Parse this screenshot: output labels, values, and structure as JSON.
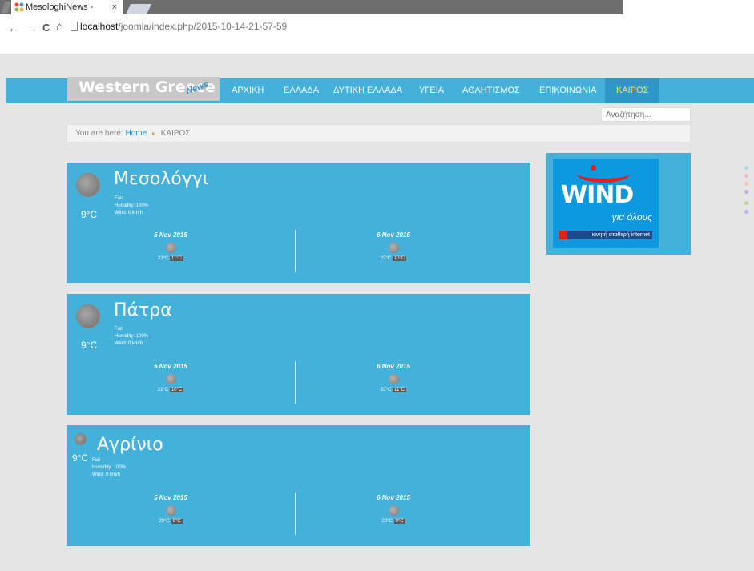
{
  "browser": {
    "tab_title": "MesologhiNews - ΚΑΙΡΟΣ",
    "tab_close": "×",
    "url_host": "localhost",
    "url_path": "/joomla/index.php/2015-10-14-21-57-59",
    "back_glyph": "←",
    "forward_glyph": "→",
    "reload_glyph": "C",
    "home_glyph": "⌂"
  },
  "site": {
    "logo": "Western Greece",
    "logo_sub": "News",
    "menu": [
      "ΑΡΧΙΚΗ",
      "ΕΛΛΑΔΑ",
      "ΔΥΤΙΚΗ ΕΛΛΑΔΑ",
      "ΥΓΕΙΑ",
      "ΑΘΛΗΤΙΣΜΟΣ",
      "ΕΠΙΚΟΙΝΩΝΙΑ",
      "ΚΑΙΡΟΣ"
    ],
    "active_menu": "ΚΑΙΡΟΣ",
    "search_placeholder": "Αναζήτηση...",
    "breadcrumb": {
      "prefix": "You are here:",
      "home": "Home",
      "current": "ΚΑΙΡΟΣ"
    }
  },
  "weather": [
    {
      "city": "Μεσολόγγι",
      "temp": "9°C",
      "condition": "Fair",
      "humidity": "Humidity: 100%",
      "wind": "Wind: 0 km/h",
      "forecast": [
        {
          "date": "5 Nov 2015",
          "high": "22°C",
          "low": "11°C"
        },
        {
          "date": "6 Nov 2015",
          "high": "22°C",
          "low": "10°C"
        }
      ]
    },
    {
      "city": "Πάτρα",
      "temp": "9°C",
      "condition": "Fair",
      "humidity": "Humidity: 100%",
      "wind": "Wind: 0 km/h",
      "forecast": [
        {
          "date": "5 Nov 2015",
          "high": "21°C",
          "low": "10°C"
        },
        {
          "date": "6 Nov 2015",
          "high": "23°C",
          "low": "11°C"
        }
      ]
    },
    {
      "city": "Αγρίνιο",
      "temp": "9°C",
      "condition": "Fair",
      "humidity": "Humidity: 100%",
      "wind": "Wind: 0 km/h",
      "forecast": [
        {
          "date": "5 Nov 2015",
          "high": "20°C",
          "low": "9°C"
        },
        {
          "date": "6 Nov 2015",
          "high": "22°C",
          "low": "9°C"
        }
      ]
    }
  ],
  "ad": {
    "brand": "WIND",
    "tagline": "για όλους",
    "line": "κινητή σταθερή internet"
  },
  "colors": {
    "header": "#44b1db",
    "active_menu_text": "#f2e85a",
    "page_bg": "#e5e5e5"
  }
}
